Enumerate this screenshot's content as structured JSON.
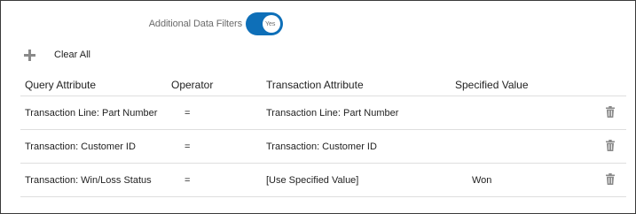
{
  "filters": {
    "label": "Additional Data Filters",
    "toggle_state": "Yes",
    "toggle_on": true,
    "accent_color": "#0e6fb8"
  },
  "toolbar": {
    "add_icon": "plus-icon",
    "clear_all_label": "Clear All"
  },
  "table": {
    "columns": [
      "Query Attribute",
      "Operator",
      "Transaction Attribute",
      "Specified Value"
    ],
    "rows": [
      {
        "query_attribute": "Transaction Line: Part Number",
        "operator": "=",
        "transaction_attribute": "Transaction Line: Part Number",
        "specified_value": ""
      },
      {
        "query_attribute": "Transaction: Customer ID",
        "operator": "=",
        "transaction_attribute": "Transaction: Customer ID",
        "specified_value": ""
      },
      {
        "query_attribute": "Transaction: Win/Loss Status",
        "operator": "=",
        "transaction_attribute": "[Use Specified Value]",
        "specified_value": "Won"
      }
    ],
    "delete_icon": "trash-icon"
  }
}
